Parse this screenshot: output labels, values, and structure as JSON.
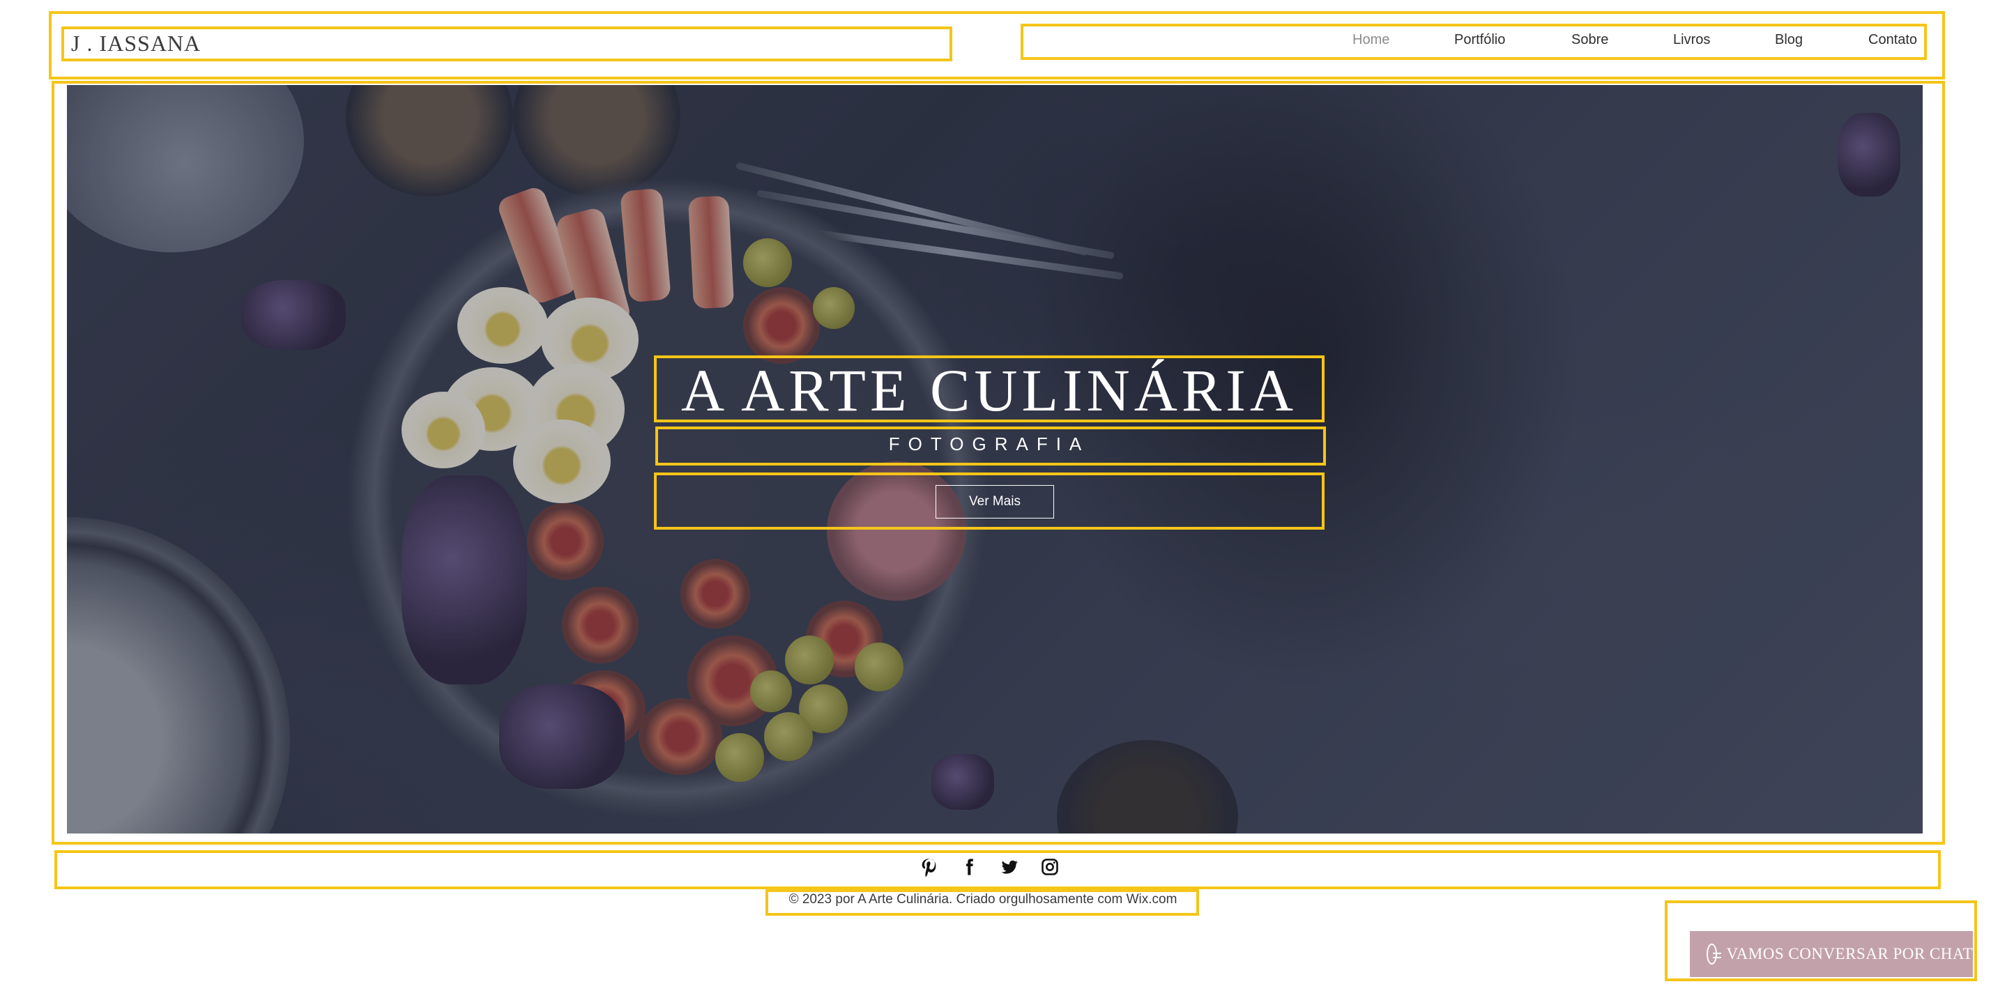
{
  "header": {
    "logo": "J . IASSANA",
    "nav": [
      {
        "label": "Home",
        "active": true
      },
      {
        "label": "Portfólio",
        "active": false
      },
      {
        "label": "Sobre",
        "active": false
      },
      {
        "label": "Livros",
        "active": false
      },
      {
        "label": "Blog",
        "active": false
      },
      {
        "label": "Contato",
        "active": false
      }
    ]
  },
  "hero": {
    "title": "A ARTE CULINÁRIA",
    "subtitle": "FOTOGRAFIA",
    "button_label": "Ver Mais"
  },
  "social": {
    "icons": [
      "pinterest-icon",
      "facebook-icon",
      "twitter-icon",
      "instagram-icon"
    ]
  },
  "footer": {
    "text": "© 2023 por A Arte Culinária. Criado orgulhosamente com Wix.com"
  },
  "chat": {
    "label": "VAMOS CONVERSAR POR CHAT",
    "icon": "chat-icon"
  },
  "colors": {
    "outline": "#f5c518",
    "chat_bg": "#c3a1ab",
    "nav_active": "#8c8c8c",
    "hero_overlay": "#2f3446"
  }
}
